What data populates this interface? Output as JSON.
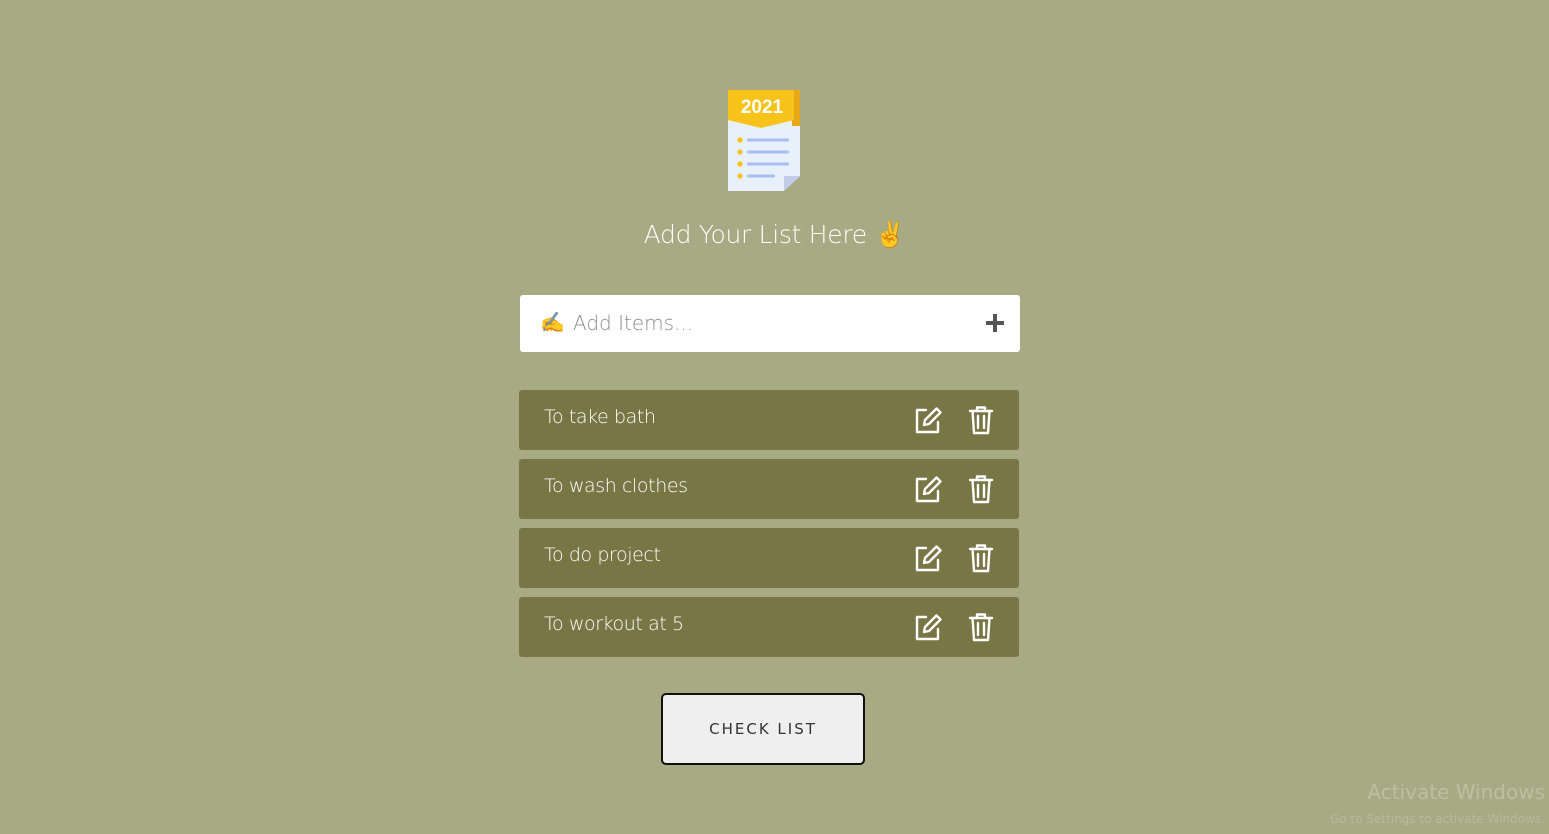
{
  "logo": {
    "year": "2021",
    "icon": "checklist-icon"
  },
  "heading": {
    "text": "Add Your List Here",
    "emoji": "✌️"
  },
  "add_item": {
    "emoji": "✍️",
    "placeholder": "Add Items...",
    "add_icon": "plus-icon"
  },
  "items": [
    {
      "label": "To take bath"
    },
    {
      "label": "To wash clothes"
    },
    {
      "label": "To do project"
    },
    {
      "label": "To workout at 5"
    }
  ],
  "check_button": {
    "label": "CHECK LIST"
  },
  "watermark": {
    "title": "Activate Windows",
    "subtitle": "Go to Settings to activate Windows."
  },
  "colors": {
    "background": "#a7aa83",
    "item_background": "#787645",
    "logo_yellow": "#f7c31a",
    "logo_paper": "#e7f0fb"
  }
}
